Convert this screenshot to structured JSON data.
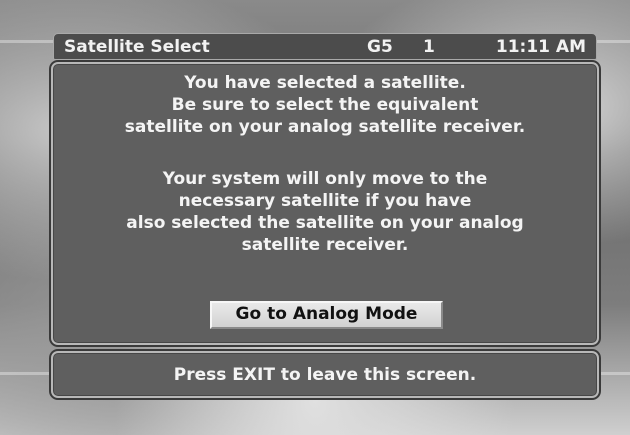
{
  "header": {
    "title": "Satellite Select",
    "satellite": "G5",
    "channel": "1",
    "time": "11:11 AM"
  },
  "message": {
    "paragraph1": "You have selected a satellite.\nBe sure to select the equivalent\nsatellite on your analog satellite receiver.",
    "paragraph2": "Your system will only move to the\nnecessary satellite if you have\nalso selected the satellite on your analog\nsatellite receiver."
  },
  "buttons": {
    "analog_mode": "Go to Analog Mode"
  },
  "footer": {
    "hint": "Press EXIT to leave this screen."
  }
}
